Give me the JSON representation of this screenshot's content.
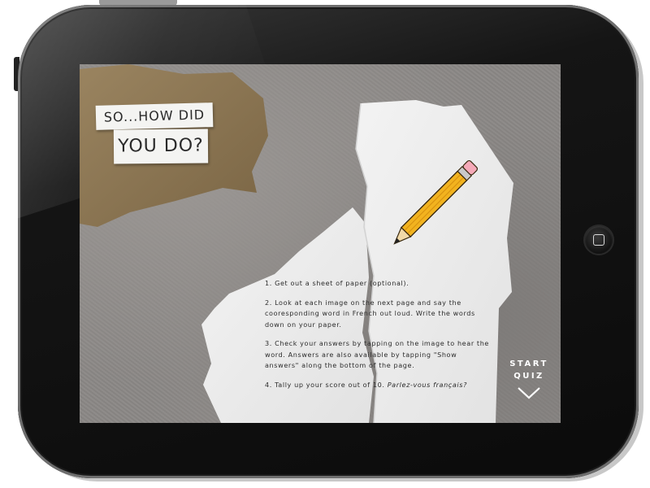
{
  "app": {
    "title_line_1": "SO...HOW DID",
    "title_line_2": "YOU DO?"
  },
  "instructions": {
    "step1": "1. Get out a sheet of paper (optional).",
    "step2": "2. Look at each image on the next page and say the cooresponding word in French out loud. Write the words down on your paper.",
    "step3": "3. Check your answers by tapping on the image to hear the word. Answers are also available by tapping \"Show answers\" along the bottom of the page.",
    "step4_prefix": "4. Tally up your score out of 10. ",
    "step4_italic": "Parlez-vous français?"
  },
  "start_quiz": {
    "line1": "START",
    "line2": "QUIZ",
    "icon": "chevron-down-icon"
  },
  "device": {
    "home_icon": "home-button-icon"
  },
  "colors": {
    "bezel": "#0f0f0f",
    "cardboard": "#8b7350",
    "paper": "#efefef",
    "pencil_body": "#f2b31f",
    "pencil_eraser": "#f5a9b8",
    "text": "#2c2c2c",
    "cta": "#ffffff"
  }
}
